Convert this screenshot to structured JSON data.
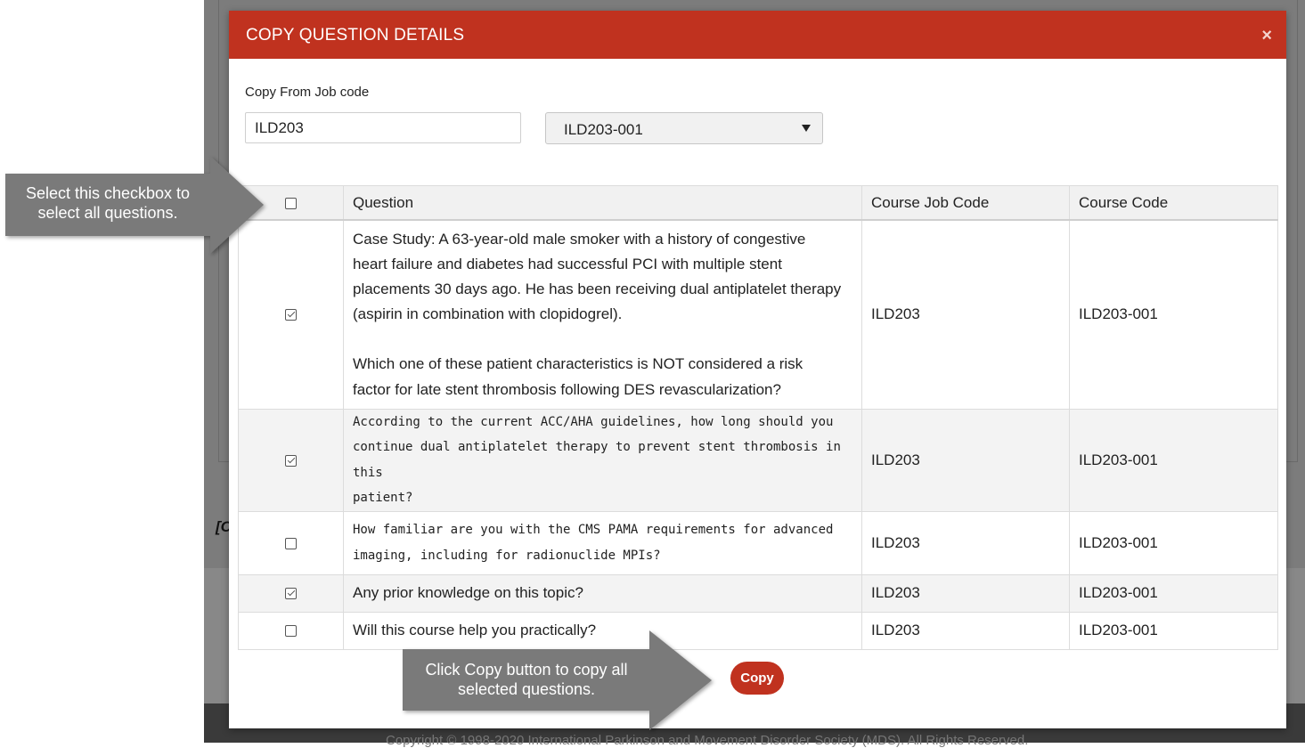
{
  "background": {
    "fragment_text": "[C",
    "footer_text": "Copyright © 1998-2020 International Parkinson and Movement Disorder Society (MDS). All Rights Reserved."
  },
  "modal": {
    "title": "COPY QUESTION DETAILS",
    "close_symbol": "×",
    "copy_from_label": "Copy From Job code",
    "job_code_value": "ILD203",
    "course_code_selected": "ILD203-001",
    "copy_button_label": "Copy"
  },
  "table": {
    "headers": {
      "question": "Question",
      "course_job_code": "Course Job Code",
      "course_code": "Course Code"
    },
    "select_all_checked": false,
    "rows": [
      {
        "checked": true,
        "question_lines": [
          "Case Study: A 63-year-old male smoker with a history of congestive",
          "heart failure and diabetes had successful PCI with multiple stent",
          "placements 30 days ago. He has been receiving dual antiplatelet therapy",
          "(aspirin in combination with clopidogrel).",
          "",
          "Which one of these patient characteristics is NOT considered a risk",
          "factor for late stent thrombosis following DES revascularization?"
        ],
        "course_job_code": "ILD203",
        "course_code": "ILD203-001"
      },
      {
        "checked": true,
        "question_lines": [
          "According to the current ACC/AHA guidelines, how long should you",
          "continue dual antiplatelet therapy to prevent stent thrombosis in this",
          "patient?"
        ],
        "course_job_code": "ILD203",
        "course_code": "ILD203-001"
      },
      {
        "checked": false,
        "question_lines": [
          "How familiar are you with the CMS PAMA requirements for advanced",
          "imaging, including for radionuclide MPIs?"
        ],
        "course_job_code": "ILD203",
        "course_code": "ILD203-001"
      },
      {
        "checked": true,
        "question": "Any prior knowledge on this topic?",
        "course_job_code": "ILD203",
        "course_code": "ILD203-001"
      },
      {
        "checked": false,
        "question": "Will this course help you practically?",
        "course_job_code": "ILD203",
        "course_code": "ILD203-001"
      }
    ]
  },
  "callouts": {
    "select_all_line1": "Select this checkbox to",
    "select_all_line2": "select all questions.",
    "copy_line1": "Click Copy button to copy all",
    "copy_line2": "selected questions."
  },
  "colors": {
    "header_red": "#c0321f",
    "overlay_gray": "#7c7c7c",
    "callout_gray": "#7a7a7a"
  }
}
